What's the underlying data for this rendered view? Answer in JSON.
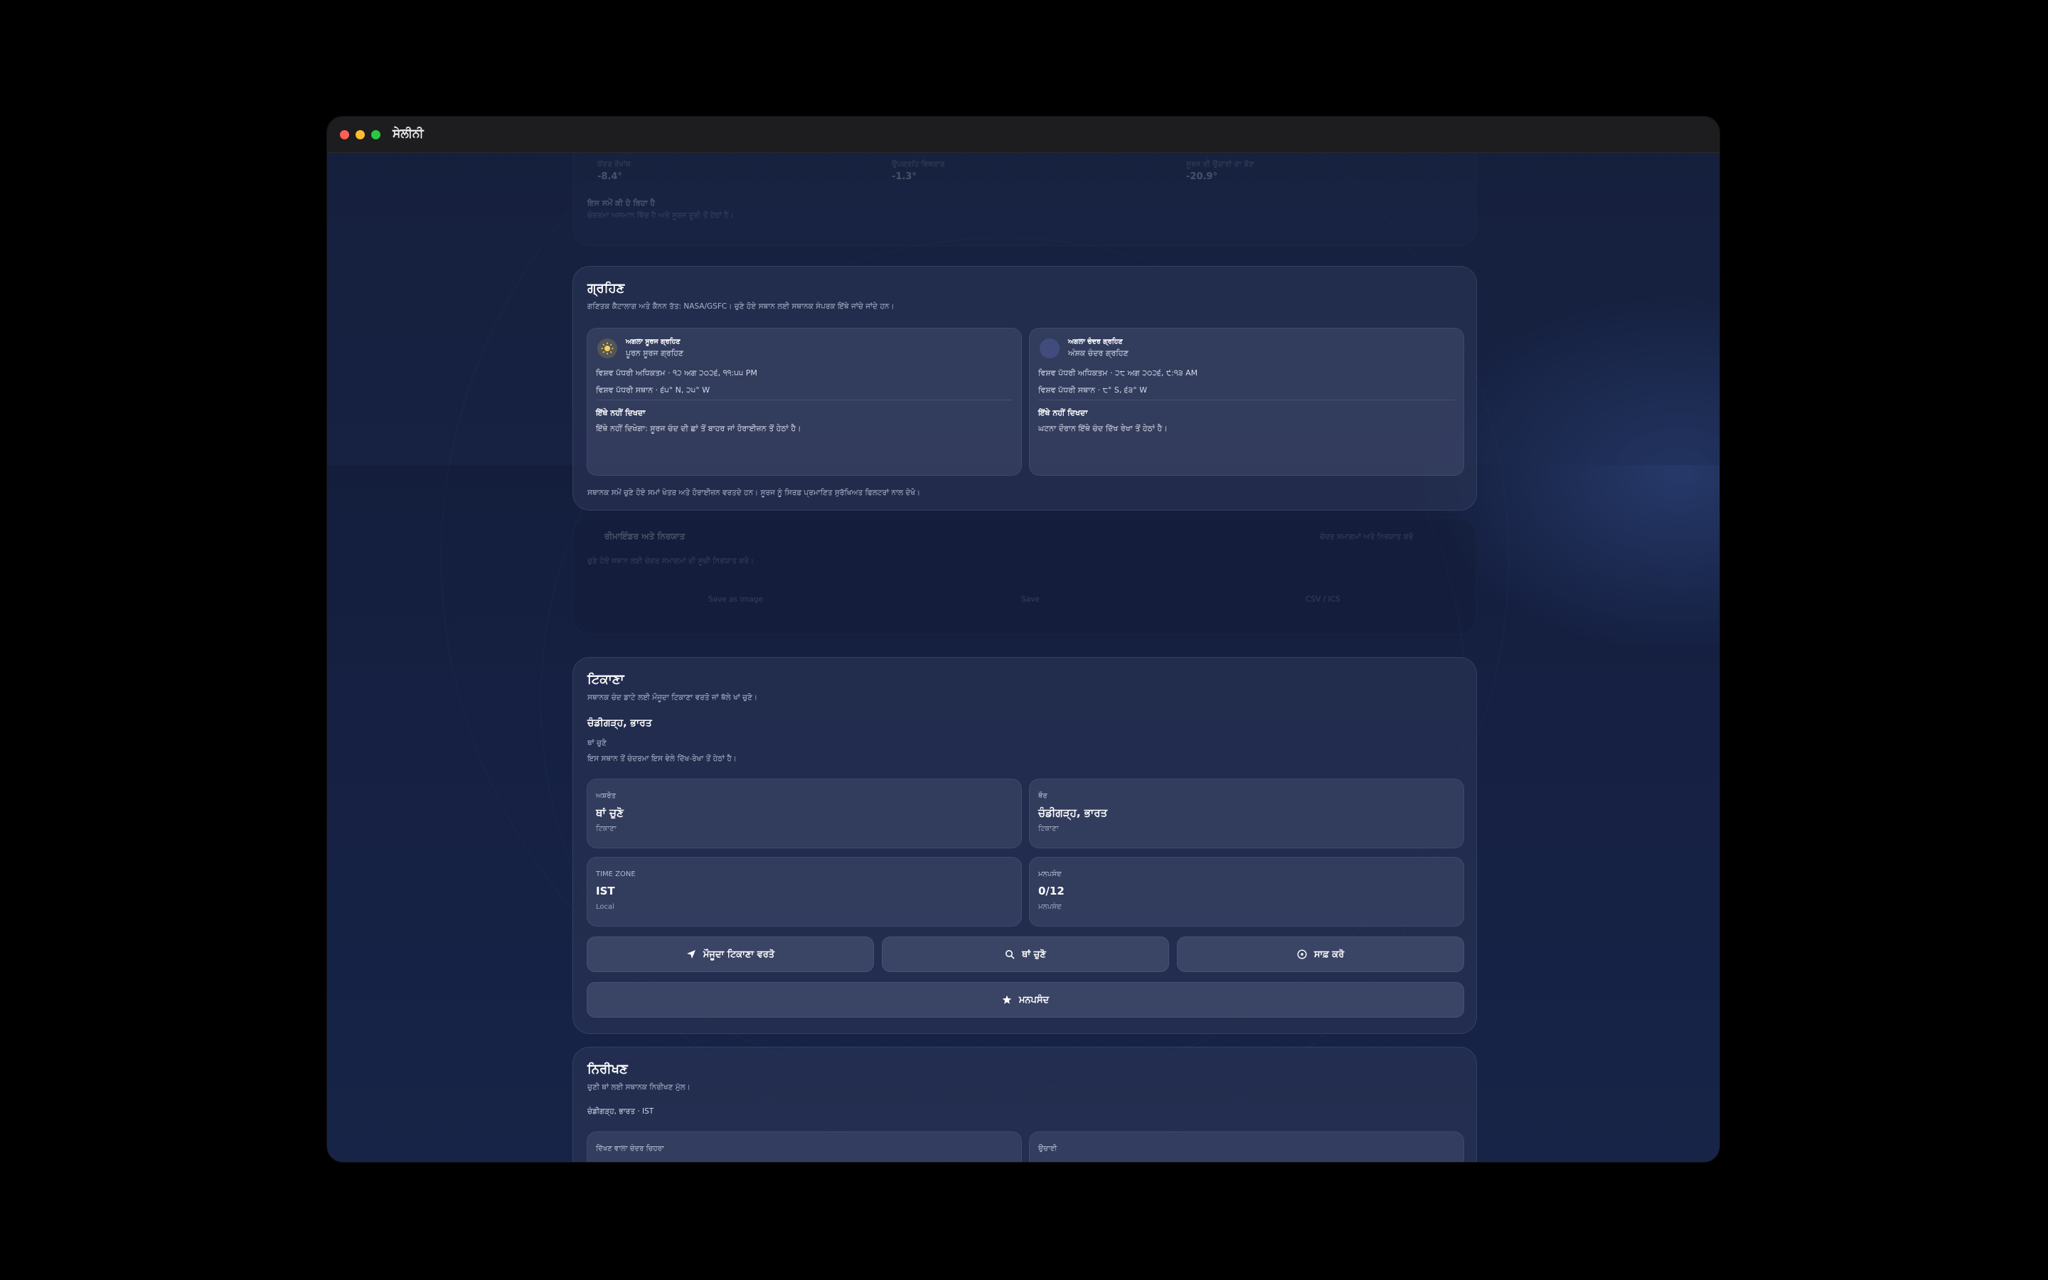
{
  "window": {
    "title": "ਸੇਲੀਨੀ"
  },
  "faded_top": {
    "labels": [
      "ਕੇਂਦਰ ਰੇਖਾਂਸ਼",
      "ਉਪਗ੍ਰਹਿ ਵਿਥਕਾਰ",
      "ਸੂਰਜ ਦੀ ਉਚਾਈ ਦਾ ਕੋਣ"
    ],
    "values": [
      "-8.4°",
      "-1.3°",
      "-20.9°"
    ],
    "note_title": "ਇਸ ਸਮੇਂ ਕੀ ਹੋ ਰਿਹਾ ਹੈ",
    "note_text": "ਚੰਦਰਮਾ ਅਸਮਾਨ ਵਿੱਚ ਹੈ ਅਤੇ ਸੂਰਜ ਦੂਰੀ ਤੋਂ ਹੇਠਾਂ ਹੈ।"
  },
  "eclipses": {
    "title": "ਗ੍ਰਹਿਣ",
    "subtitle": "ਗਣਿਤਕ ਕੈਟਾਲਾਗ ਅਤੇ ਕੈਨਨ ਤੱਤ: NASA/GSFC। ਚੁਣੇ ਹੋਏ ਸਥਾਨ ਲਈ ਸਥਾਨਕ ਸੰਪਰਕ ਇੱਥੇ ਜਾਂਚੇ ਜਾਂਦੇ ਹਨ।",
    "items": [
      {
        "kind_label": "ਅਗਲਾ ਸੂਰਜ ਗ੍ਰਹਿਣ",
        "type": "ਪੂਰਨ ਸੂਰਜ ਗ੍ਰਹਿਣ",
        "line1": "ਵਿਸ਼ਵ ਪੱਧਰੀ ਅਧਿਕਤਮ · ੧੨ ਅਗ ੨੦੨੬, ੧੧:੫੫ PM",
        "line2": "ਵਿਸ਼ਵ ਪੱਧਰੀ ਸਥਾਨ · ੬੫° N, ੨੫° W",
        "vis_title": "ਇੱਥੇ ਨਹੀਂ ਦਿਖਦਾ",
        "vis_text": "ਇੱਥੇ ਨਹੀਂ ਦਿਖੇਗਾ: ਸੂਰਜ ਚੰਦ ਦੀ ਛਾਂ ਤੋਂ ਬਾਹਰ ਜਾਂ ਹੋਰਾਈਜ਼ਨ ਤੋਂ ਹੇਠਾਂ ਹੈ।",
        "icon": "sun-icon"
      },
      {
        "kind_label": "ਅਗਲਾ ਚੰਦਰ ਗ੍ਰਹਿਣ",
        "type": "ਅੰਸ਼ਕ ਚੰਦਰ ਗ੍ਰਹਿਣ",
        "line1": "ਵਿਸ਼ਵ ਪੱਧਰੀ ਅਧਿਕਤਮ · ੨੮ ਅਗ ੨੦੨੬, ੯:੧੩ AM",
        "line2": "ਵਿਸ਼ਵ ਪੱਧਰੀ ਸਥਾਨ · ੮° S, ੬੩° W",
        "vis_title": "ਇੱਥੇ ਨਹੀਂ ਦਿਖਦਾ",
        "vis_text": "ਘਟਨਾ ਦੌਰਾਨ ਇੱਥੇ ਚੰਦ ਦਿੱਖ ਰੇਖਾ ਤੋਂ ਹੇਠਾਂ ਹੈ।",
        "icon": "moon-icon"
      }
    ],
    "footer": "ਸਥਾਨਕ ਸਮੇਂ ਚੁਣੇ ਹੋਏ ਸਮਾਂ ਖੇਤਰ ਅਤੇ ਹੋਰਾਈਜ਼ਨ ਵਰਤਦੇ ਹਨ। ਸੂਰਜ ਨੂੰ ਸਿਰਫ਼ ਪ੍ਰਮਾਣਿਤ ਸੁਰੱਖਿਅਤ ਫਿਲਟਰਾਂ ਨਾਲ ਦੇਖੋ।"
  },
  "faded_mid": {
    "title": "ਰੀਮਾਇੰਡਰ ਅਤੇ ਨਿਰਯਾਤ",
    "action": "ਚੰਦਰ ਸਮਾਗਮਾਂ ਅਤੇ ਨਿਰਯਾਤ ਕਰੋ",
    "sub": "ਚੁਣੇ ਹੋਏ ਸਥਾਨ ਲਈ ਚੰਦਰ ਸਮਾਗਮਾਂ ਦੀ ਸੂਚੀ ਨਿਰਯਾਤ ਕਰੋ।",
    "buttons": [
      "Save as image",
      "Save",
      "CSV / ICS"
    ]
  },
  "location": {
    "title": "ਟਿਕਾਣਾ",
    "subtitle": "ਸਥਾਨਕ ਚੰਦ ਡਾਟੇ ਲਈ ਮੌਜੂਦਾ ਟਿਕਾਣਾ ਵਰਤੋ ਜਾਂ ਥੱਲੇ ਖਾਂ ਚੁਣੋ।",
    "current_place": "ਚੰਡੀਗੜ੍ਹ, ਭਾਰਤ",
    "mode": "ਥਾਂ ਚੁਣੋ",
    "mode_note": "ਇਸ ਸਥਾਨ ਤੋਂ ਚੰਦਰਮਾ ਇਸ ਵੇਲੇ ਦਿੱਖ-ਰੇਖਾ ਤੋਂ ਹੇਠਾਂ ਹੈ।",
    "tiles": [
      {
        "label": "ਅਸ਼ਰੋਤ",
        "value": "ਥਾਂ ਚੁਣੋ",
        "sub": "ਟਿਕਾਣਾ"
      },
      {
        "label": "ਥੌਰ",
        "value": "ਚੰਡੀਗੜ੍ਹ, ਭਾਰਤ",
        "sub": "ਟਿਕਾਣਾ"
      },
      {
        "label": "TIME ZONE",
        "value": "IST",
        "sub": "Local"
      },
      {
        "label": "ਮਨਪਸੰਦ",
        "value": "0/12",
        "sub": "ਮਨਪਸੰਦ"
      }
    ],
    "buttons": {
      "use_current": "ਮੌਜੂਦਾ ਟਿਕਾਣਾ ਵਰਤੋ",
      "choose": "ਥਾਂ ਚੁਣੋ",
      "clear": "ਸਾਫ਼ ਕਰੋ",
      "favorites": "ਮਨਪਸੰਦ"
    }
  },
  "observation": {
    "title": "ਨਿਰੀਖਣ",
    "subtitle": "ਚੁਣੀ ਥਾਂ ਲਈ ਸਥਾਨਕ ਨਿਰੀਖਣ ਮੁੱਲ।",
    "place": "ਚੰਡੀਗੜ੍ਹ, ਭਾਰਤ · IST",
    "tile_labels": [
      "ਦਿੱਖਣ ਵਾਲਾ ਚੰਦਰ ਚਿਹਰਾ",
      "ਉਚਾਈ"
    ]
  }
}
